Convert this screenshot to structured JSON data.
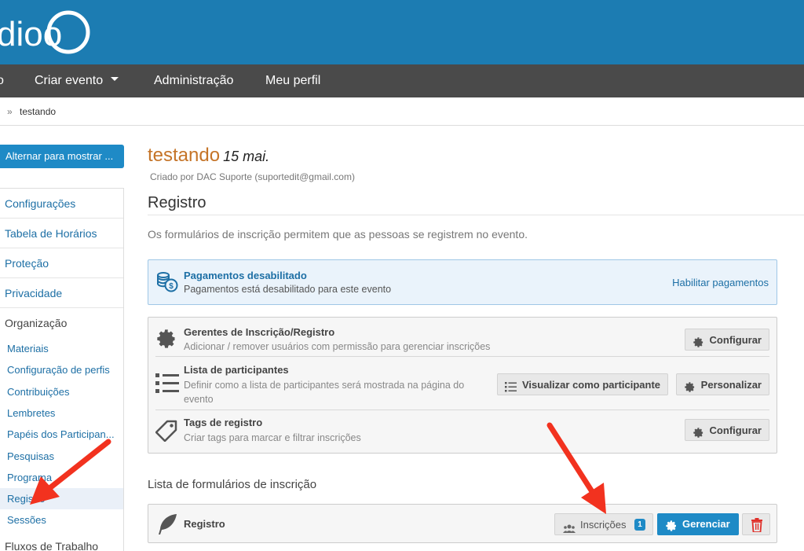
{
  "header": {
    "logo_text": "dioo"
  },
  "nav": {
    "items": [
      {
        "label": "o"
      },
      {
        "label": "Criar evento"
      },
      {
        "label": "Administração"
      },
      {
        "label": "Meu perfil"
      }
    ]
  },
  "breadcrumb": {
    "separator": "»",
    "current": "testando"
  },
  "sidebar": {
    "toggle_label": "Alternar para mostrar ...",
    "items": [
      "Configurações",
      "Tabela de Horários",
      "Proteção",
      "Privacidade"
    ],
    "section_organizacao": "Organização",
    "sub_items": [
      "Materiais",
      "Configuração de perfis",
      "Contribuições",
      "Lembretes",
      "Papéis dos Participan...",
      "Pesquisas",
      "Programa",
      "Registro",
      "Sessões"
    ],
    "section_fluxos": "Fluxos de Trabalho"
  },
  "event": {
    "title": "testando",
    "date": "15 mai.",
    "creator": "Criado por DAC Suporte (suportedit@gmail.com)"
  },
  "section": {
    "title": "Registro",
    "description": "Os formulários de inscrição permitem que as pessoas se registrem no evento."
  },
  "payments": {
    "title": "Pagamentos desabilitado",
    "subtitle": "Pagamentos está desabilitado para este evento",
    "link": "Habilitar pagamentos"
  },
  "config": {
    "managers": {
      "title": "Gerentes de Inscrição/Registro",
      "subtitle": "Adicionar / remover usuários com permissão para gerenciar inscrições",
      "button": "Configurar"
    },
    "participants": {
      "title": "Lista de participantes",
      "subtitle_line1": "Definir como a lista de participantes será mostrada na página do",
      "subtitle_line2": "evento",
      "view_button": "Visualizar como participante",
      "customize_button": "Personalizar"
    },
    "tags": {
      "title": "Tags de registro",
      "subtitle": "Criar tags para marcar e filtrar inscrições",
      "button": "Configurar"
    }
  },
  "forms": {
    "heading": "Lista de formulários de inscrição",
    "items": [
      {
        "name": "Registro",
        "inscriptions_label": "Inscrições",
        "count": "1",
        "manage_label": "Gerenciar"
      }
    ]
  },
  "colors": {
    "brand": "#1c7cb2",
    "navbar": "#4a4a4a",
    "accent": "#1e8ac6",
    "title_orange": "#c57428",
    "delete_red": "#e0312b",
    "annotation_arrow": "#f2321f"
  }
}
